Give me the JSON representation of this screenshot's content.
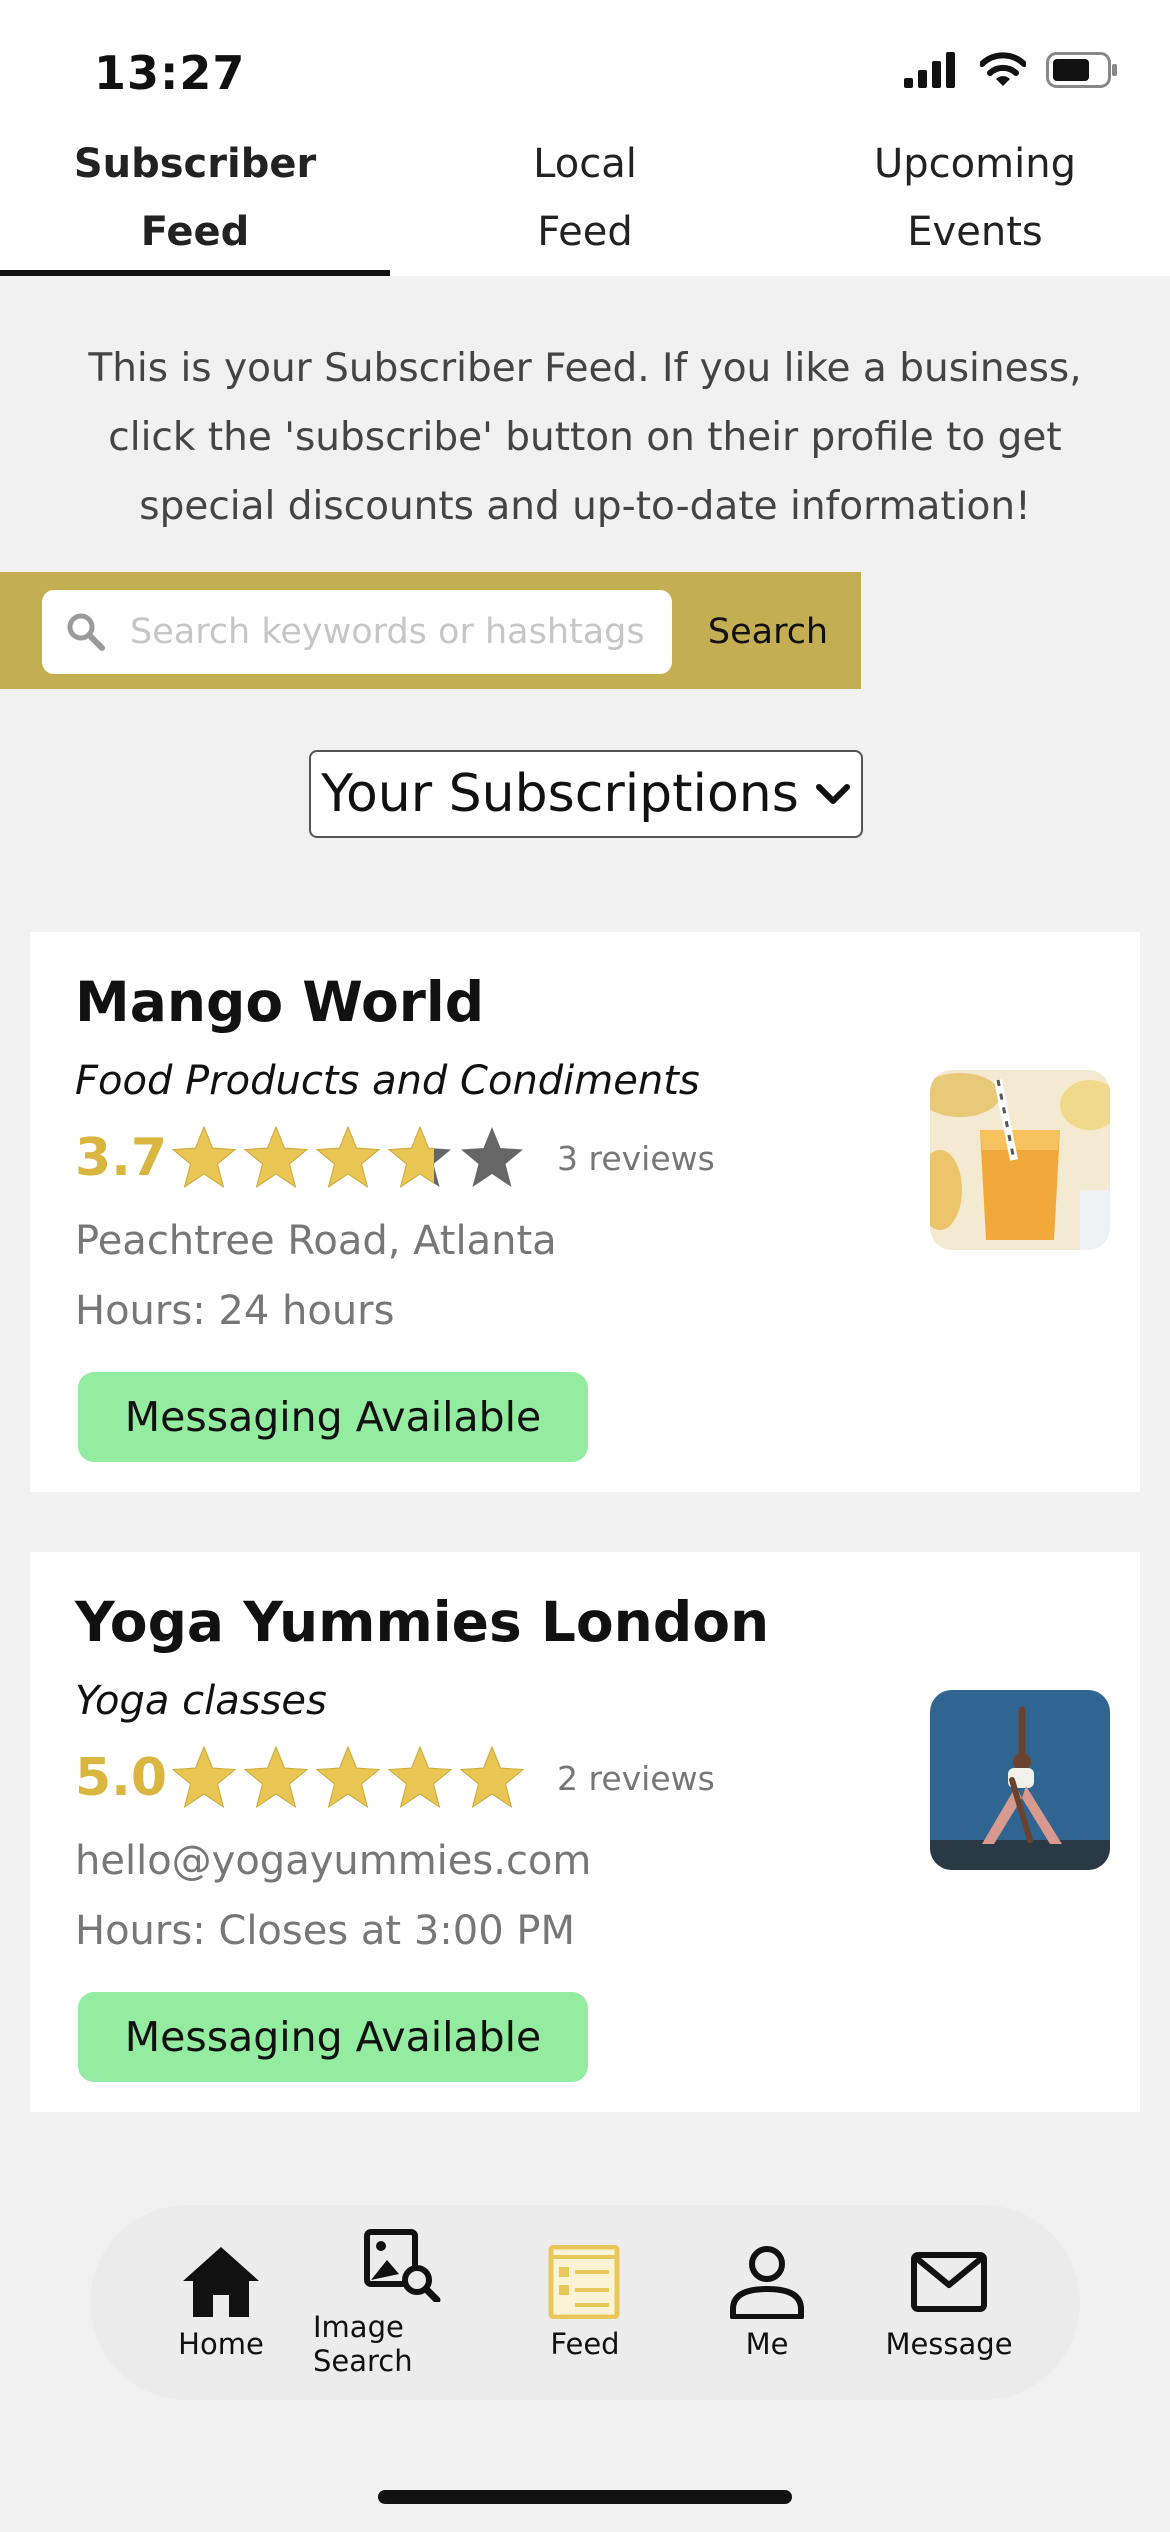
{
  "status_bar": {
    "time": "13:27"
  },
  "tabs": [
    {
      "line1": "Subscriber",
      "line2": "Feed"
    },
    {
      "line1": "Local",
      "line2": "Feed"
    },
    {
      "line1": "Upcoming",
      "line2": "Events"
    }
  ],
  "intro_text": "This is your Subscriber Feed. If you like a business, click the 'subscribe' button on their profile to get special discounts and up-to-date information!",
  "search": {
    "placeholder": "Search keywords or hashtags",
    "button_label": "Search"
  },
  "subscriptions_dropdown": {
    "label": "Your Subscriptions"
  },
  "cards": [
    {
      "name": "Mango World",
      "category": "Food Products and Condiments",
      "rating": "3.7",
      "rating_value": 3.7,
      "reviews": "3 reviews",
      "detail": "Peachtree Road, Atlanta",
      "hours_label": "Hours:",
      "hours_value": "24 hours",
      "message_badge": "Messaging Available"
    },
    {
      "name": "Yoga Yummies London",
      "category": "Yoga classes",
      "rating": "5.0",
      "rating_value": 5.0,
      "reviews": "2 reviews",
      "detail": "hello@yogayummies.com",
      "hours_label": "Hours:",
      "hours_value": "Closes at 3:00 PM",
      "message_badge": "Messaging Available"
    }
  ],
  "bottom_nav": [
    {
      "label": "Home",
      "icon": "home-icon"
    },
    {
      "label": "Image Search",
      "icon": "image-search-icon"
    },
    {
      "label": "Feed",
      "icon": "feed-icon"
    },
    {
      "label": "Me",
      "icon": "person-icon"
    },
    {
      "label": "Message",
      "icon": "envelope-icon"
    }
  ],
  "colors": {
    "accent_gold": "#c4ae54",
    "star_gold": "#e9c653",
    "star_gray": "#666666",
    "badge_green": "#93ec9f",
    "feed_icon": "#e8c85a"
  }
}
